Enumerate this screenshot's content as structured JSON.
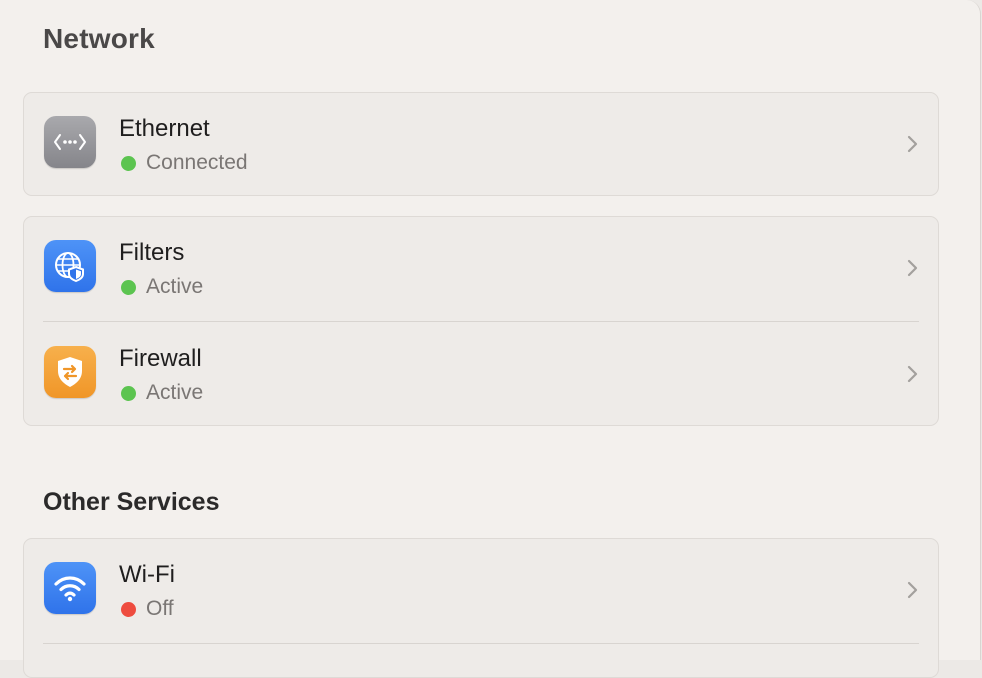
{
  "header": {
    "title": "Network"
  },
  "groups": [
    {
      "items": [
        {
          "label": "Ethernet",
          "status": "Connected",
          "status_color": "#5cc450",
          "icon": "ethernet-icon"
        }
      ]
    },
    {
      "items": [
        {
          "label": "Filters",
          "status": "Active",
          "status_color": "#5cc450",
          "icon": "globe-shield-icon"
        },
        {
          "label": "Firewall",
          "status": "Active",
          "status_color": "#5cc450",
          "icon": "firewall-shield-icon"
        }
      ]
    }
  ],
  "other_services": {
    "title": "Other Services",
    "items": [
      {
        "label": "Wi-Fi",
        "status": "Off",
        "status_color": "#ee4c3f",
        "icon": "wifi-icon"
      }
    ]
  },
  "colors": {
    "status_on": "#5cc450",
    "status_off": "#ee4c3f",
    "accent_blue": "#3b82f6",
    "accent_orange": "#f5a23a"
  }
}
